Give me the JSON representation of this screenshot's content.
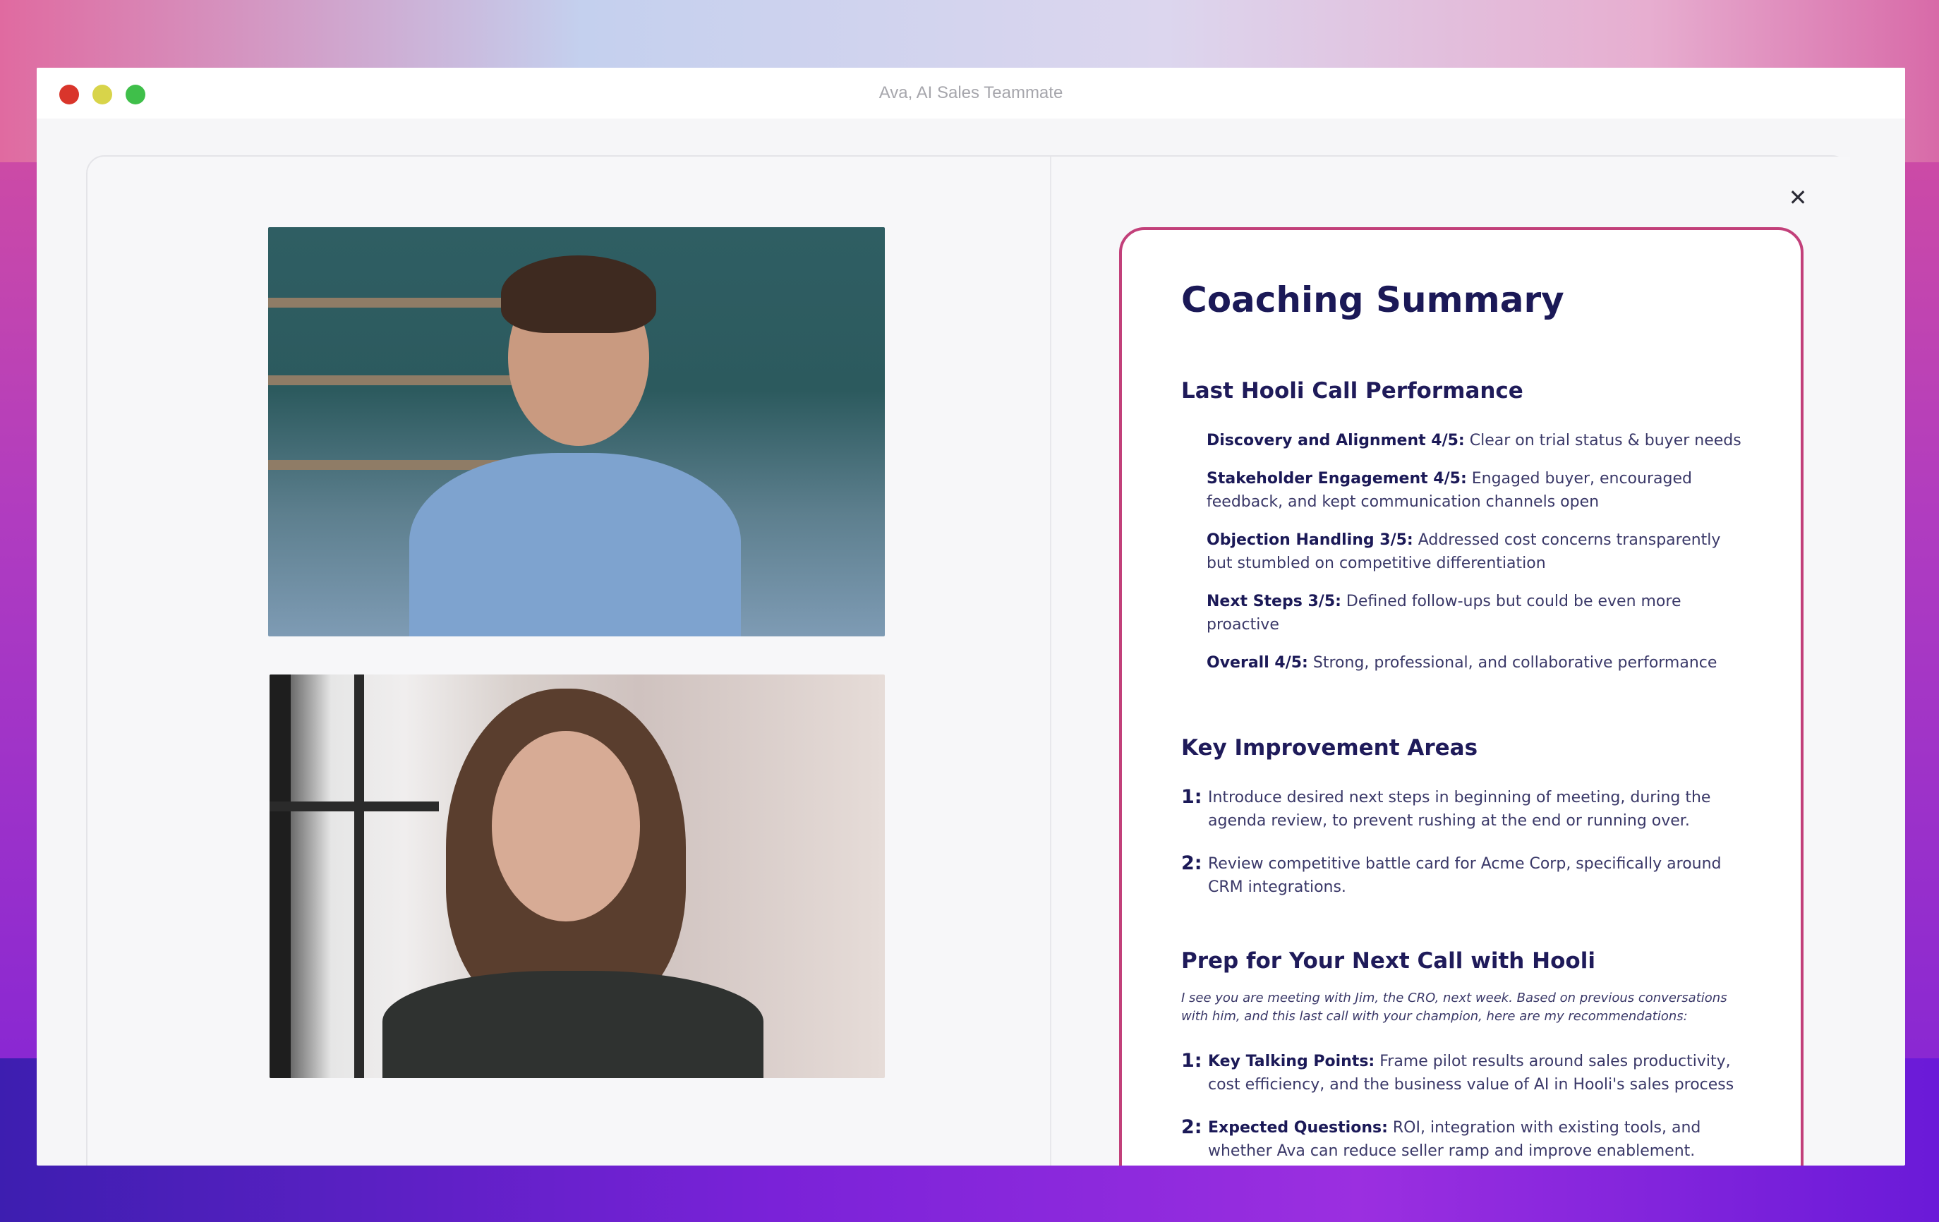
{
  "window": {
    "title": "Ava, AI Sales Teammate"
  },
  "colors": {
    "accent": "#c2407a",
    "heading": "#1b1957",
    "body_text": "#3a3868"
  },
  "icons": {
    "close": "close-icon",
    "traffic_lights": [
      "close-window-dot",
      "minimize-window-dot",
      "zoom-window-dot"
    ]
  },
  "summary": {
    "title": "Coaching Summary",
    "performance": {
      "heading": "Last Hooli Call Performance",
      "items": [
        {
          "label": "Discovery and Alignment 4/5:",
          "text": " Clear on trial status & buyer needs"
        },
        {
          "label": "Stakeholder Engagement 4/5:",
          "text": " Engaged buyer, encouraged feedback, and kept communication channels open"
        },
        {
          "label": "Objection Handling 3/5:",
          "text": " Addressed cost concerns transparently but stumbled on competitive differentiation"
        },
        {
          "label": "Next Steps 3/5:",
          "text": " Defined follow-ups but could be even more proactive"
        },
        {
          "label": "Overall 4/5:",
          "text": " Strong, professional, and collaborative performance"
        }
      ]
    },
    "improvement": {
      "heading": "Key Improvement Areas",
      "items": [
        {
          "num": "1:",
          "text": "Introduce desired next steps in beginning of meeting, during the agenda review, to prevent rushing at the end or running over."
        },
        {
          "num": "2:",
          "text": "Review competitive battle card for Acme Corp, specifically around CRM integrations."
        }
      ]
    },
    "prep": {
      "heading": "Prep for Your Next Call with Hooli",
      "intro": "I see you are meeting with Jim, the CRO, next week. Based on previous conversations with him, and this last call with your champion, here are my recommendations:",
      "items": [
        {
          "num": "1:",
          "label": "Key Talking Points:",
          "text": " Frame pilot results around sales productivity, cost efficiency, and the business value of AI in Hooli's sales process"
        },
        {
          "num": "2:",
          "label": "Expected Questions:",
          "text": " ROI, integration with existing tools, and whether Ava can reduce seller ramp and improve enablement."
        }
      ]
    }
  }
}
